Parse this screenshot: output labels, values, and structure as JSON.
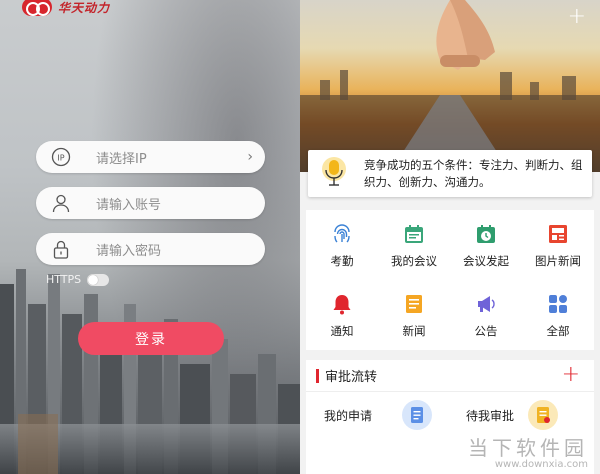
{
  "login": {
    "logo_text": "华天动力",
    "ip_placeholder": "请选择IP",
    "account_placeholder": "请输入账号",
    "password_placeholder": "请输入密码",
    "https_label": "HTTPS",
    "login_button": "登录"
  },
  "home": {
    "notice_text": "竞争成功的五个条件：专注力、判断力、组织力、创新力、沟通力。",
    "grid": [
      {
        "label": "考勤",
        "icon": "fingerprint-icon"
      },
      {
        "label": "我的会议",
        "icon": "calendar-icon"
      },
      {
        "label": "会议发起",
        "icon": "meeting-start-icon"
      },
      {
        "label": "图片新闻",
        "icon": "picture-news-icon"
      },
      {
        "label": "通知",
        "icon": "bell-icon"
      },
      {
        "label": "新闻",
        "icon": "news-icon"
      },
      {
        "label": "公告",
        "icon": "megaphone-icon"
      },
      {
        "label": "全部",
        "icon": "all-apps-icon"
      }
    ],
    "approval_title": "审批流转",
    "my_request": "我的申请",
    "pending_approval": "待我审批"
  },
  "watermark": {
    "cn": "当下软件园",
    "url": "www.downxia.com"
  },
  "colors": {
    "brand_red": "#e0262e",
    "login_button": "#f04b63"
  }
}
